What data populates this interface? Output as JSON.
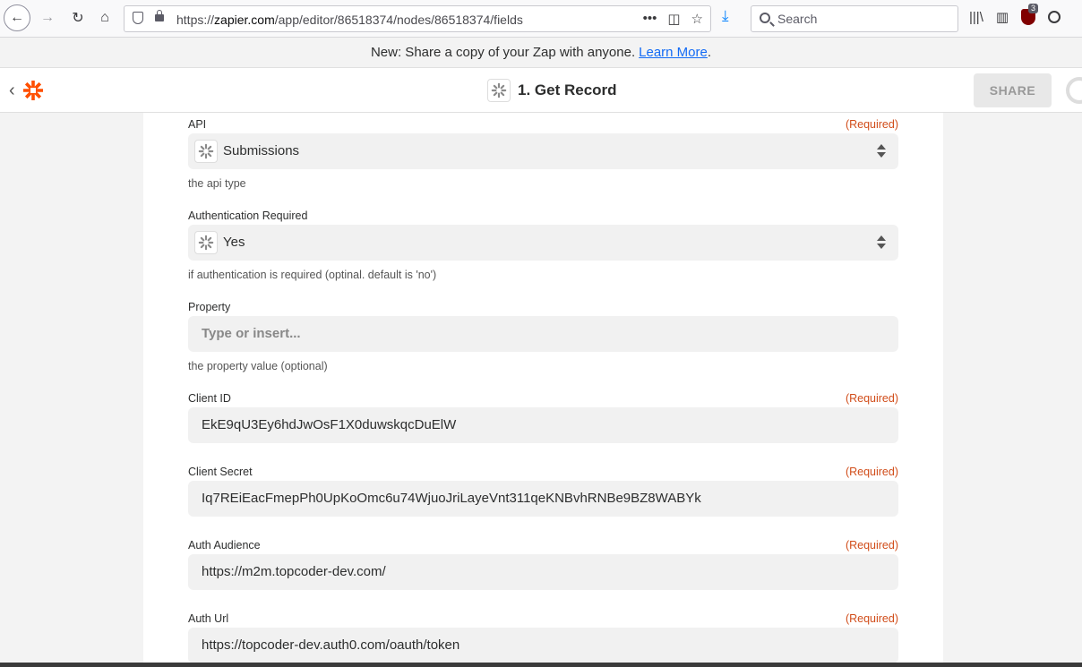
{
  "browser": {
    "url_prefix": "https://",
    "url_host": "zapier.com",
    "url_path": "/app/editor/86518374/nodes/86518374/fields",
    "url_more": "•••",
    "search_placeholder": "Search",
    "ublock_badge": "3"
  },
  "banner": {
    "text": "New: Share a copy of your Zap with anyone.",
    "link": "Learn More",
    "suffix": "."
  },
  "header": {
    "step_title": "1. Get Record",
    "share_label": "SHARE"
  },
  "fields": {
    "api": {
      "label": "API",
      "required": "(Required)",
      "value": "Submissions",
      "help": "the api type"
    },
    "auth_required": {
      "label": "Authentication Required",
      "value": "Yes",
      "help": "if authentication is required (optinal. default is 'no')"
    },
    "property": {
      "label": "Property",
      "placeholder": "Type or insert...",
      "help": "the property value (optional)"
    },
    "client_id": {
      "label": "Client ID",
      "required": "(Required)",
      "value": "EkE9qU3Ey6hdJwOsF1X0duwskqcDuElW"
    },
    "client_secret": {
      "label": "Client Secret",
      "required": "(Required)",
      "value": "Iq7REiEacFmepPh0UpKoOmc6u74WjuoJriLayeVnt311qeKNBvhRNBe9BZ8WABYk"
    },
    "auth_audience": {
      "label": "Auth Audience",
      "required": "(Required)",
      "value": "https://m2m.topcoder-dev.com/"
    },
    "auth_url": {
      "label": "Auth Url",
      "required": "(Required)",
      "value": "https://topcoder-dev.auth0.com/oauth/token"
    }
  },
  "colors": {
    "required": "#d14d1a",
    "link": "#136bf5",
    "zapier_orange": "#ff4f00"
  }
}
